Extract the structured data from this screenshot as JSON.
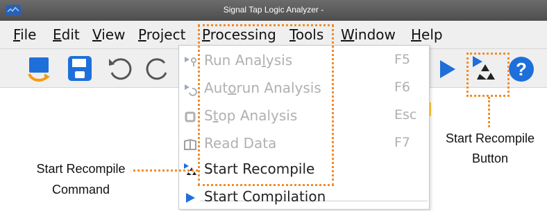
{
  "window": {
    "title": "Signal Tap Logic Analyzer -"
  },
  "menubar": {
    "items": [
      {
        "acc": "F",
        "rest": "ile"
      },
      {
        "acc": "E",
        "rest": "dit"
      },
      {
        "acc": "V",
        "rest": "iew"
      },
      {
        "acc": "P",
        "rest": "roject"
      },
      {
        "acc": "P",
        "rest": "rocessing"
      },
      {
        "acc": "T",
        "rest": "ools"
      },
      {
        "acc": "W",
        "rest": "indow"
      },
      {
        "acc": "H",
        "rest": "elp"
      }
    ]
  },
  "processing_menu": {
    "items": [
      {
        "pre": "Run Ana",
        "acc": "l",
        "post": "ysis",
        "shortcut": "F5",
        "icon": "run-analysis-icon",
        "enabled": false
      },
      {
        "pre": "Aut",
        "acc": "o",
        "post": "run Analysis",
        "shortcut": "F6",
        "icon": "autorun-analysis-icon",
        "enabled": false
      },
      {
        "pre": "S",
        "acc": "t",
        "post": "op Analysis",
        "shortcut": "Esc",
        "icon": "stop-analysis-icon",
        "enabled": false
      },
      {
        "pre": "Read Data",
        "acc": "",
        "post": "",
        "shortcut": "F7",
        "icon": "read-data-icon",
        "enabled": false
      },
      {
        "pre": "Start Recompile",
        "acc": "",
        "post": "",
        "shortcut": "",
        "icon": "start-recompile-icon",
        "enabled": true
      },
      {
        "pre": "Start Compilation",
        "acc": "",
        "post": "",
        "shortcut": "",
        "icon": "start-compilation-icon",
        "enabled": true
      }
    ]
  },
  "callouts": {
    "command_line1": "Start Recompile",
    "command_line2": "Command",
    "button_line1": "Start Recompile",
    "button_line2": "Button"
  },
  "colors": {
    "highlight": "#f08c2a",
    "accent_blue": "#1e6fd9",
    "orange": "#f39c12"
  }
}
